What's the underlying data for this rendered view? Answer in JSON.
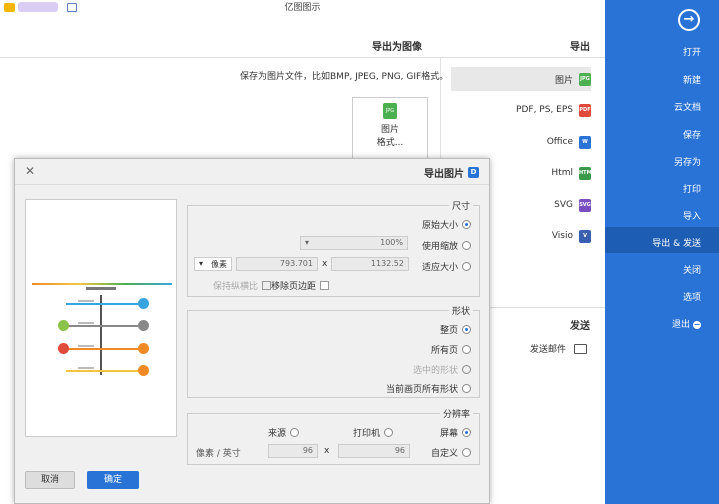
{
  "title": "亿图图示",
  "nav": {
    "items": [
      "打开",
      "新建",
      "云文档",
      "保存",
      "另存为",
      "打印",
      "导入",
      "导出 & 发送",
      "关闭",
      "选项",
      "退出"
    ],
    "active_index": 7
  },
  "export": {
    "section_title": "导出",
    "sub_title": "导出为图像",
    "formats": [
      "图片",
      "PDF, PS, EPS",
      "Office",
      "Html",
      "SVG",
      "Visio"
    ],
    "description": "保存为图片文件，比如BMP, JPEG, PNG, GIF格式。",
    "card_label_1": "图片",
    "card_label_2": "格式...",
    "card_icon": "JPG"
  },
  "send": {
    "section_title": "发送",
    "email_label": "发送邮件"
  },
  "dialog": {
    "title": "导出图片",
    "size": {
      "label": "尺寸",
      "original": "原始大小",
      "zoom": "使用缩放",
      "zoom_value": "100%",
      "fit": "适应大小",
      "width": "1132.52",
      "height": "793.701",
      "unit": "像素",
      "x_sep": "x",
      "remove_margin": "移除页边距",
      "keep_ratio": "保持纵横比"
    },
    "shape": {
      "label": "形状",
      "whole_page": "整页",
      "all_pages": "所有页",
      "selected": "选中的形状",
      "current_all": "当前画页所有形状"
    },
    "resolution": {
      "label": "分辨率",
      "screen": "屏幕",
      "printer": "打印机",
      "source": "来源",
      "custom": "自定义",
      "dpi_x": "96",
      "dpi_y": "96",
      "x_sep": "x",
      "unit": "像素 / 英寸"
    },
    "ok": "确定",
    "cancel": "取消"
  }
}
